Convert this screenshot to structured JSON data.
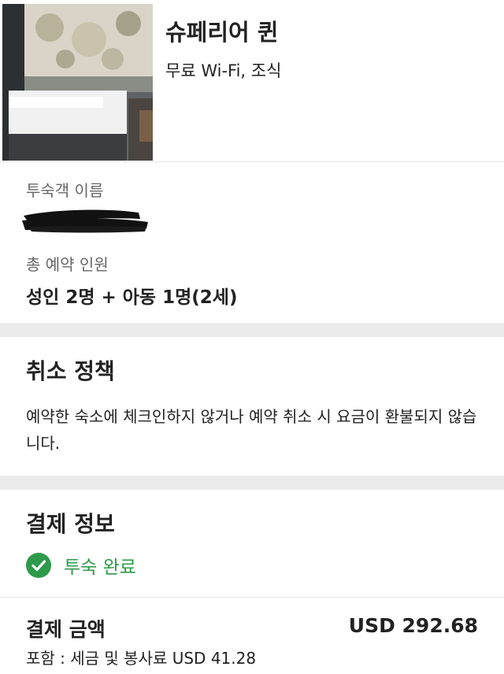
{
  "room": {
    "image": "hotel-room-photo",
    "title": "슈페리어 퀸",
    "amenities": "무료 Wi-Fi, 조식"
  },
  "guest": {
    "name_label": "투숙객 이름",
    "name_redacted": true,
    "pax_label": "총 예약 인원",
    "pax_value": "성인 2명 + 아동 1명(2세)"
  },
  "policy": {
    "title": "취소 정책",
    "text": "예약한 숙소에 체크인하지 않거나 예약 취소 시 요금이 환불되지 않습니다."
  },
  "payment": {
    "title": "결제 정보",
    "status_icon": "check-circle-icon",
    "status": "투숙 완료",
    "status_color": "#2e9a4b",
    "amount_label": "결제 금액",
    "amount_value": "USD 292.68",
    "tax_note": "포함 : 세금 및 봉사료 USD 41.28"
  }
}
